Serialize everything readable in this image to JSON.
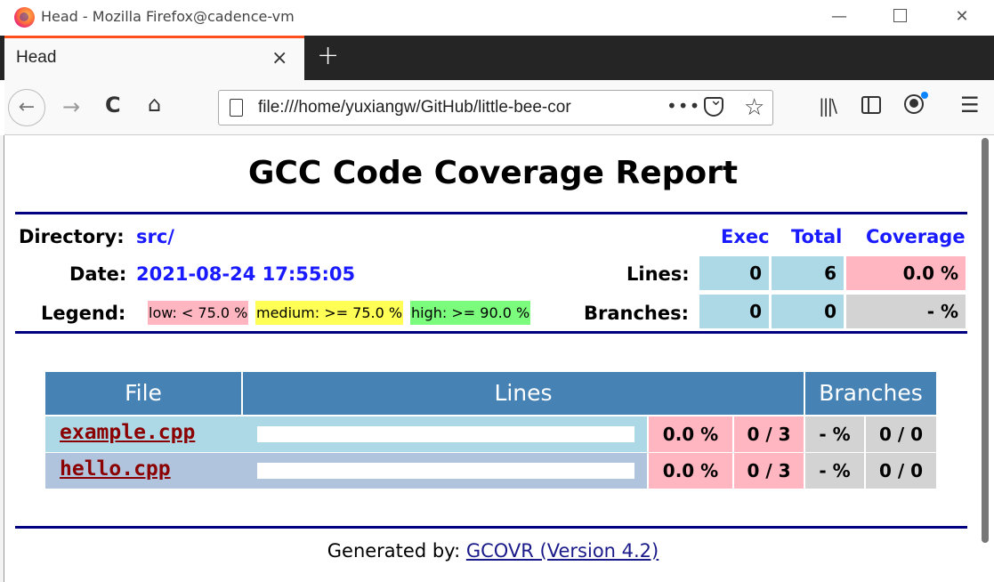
{
  "window": {
    "title": "Head - Mozilla Firefox@cadence-vm",
    "min_glyph": "—",
    "close_glyph": "✕"
  },
  "tab": {
    "label": "Head",
    "close_glyph": "×",
    "new_tab_glyph": "+"
  },
  "nav": {
    "back_glyph": "←",
    "forward_glyph": "→",
    "reload_glyph": "C",
    "home_glyph": "⌂",
    "url": "file:///home/yuxiangw/GitHub/little-bee-cor",
    "more_glyph": "•••",
    "star_glyph": "☆",
    "library_glyph": "|||\\",
    "menu_glyph": "☰",
    "account_dot_color": "#0a84ff"
  },
  "report": {
    "title": "GCC Code Coverage Report",
    "directory_label": "Directory:",
    "directory_value": "src/",
    "date_label": "Date:",
    "date_value": "2021-08-24 17:55:05",
    "legend_label": "Legend:",
    "legend": {
      "low": "low: < 75.0 %",
      "medium": "medium: >= 75.0 %",
      "high": "high: >= 90.0 %"
    },
    "columns": {
      "exec": "Exec",
      "total": "Total",
      "coverage": "Coverage"
    },
    "lines": {
      "label": "Lines:",
      "exec": "0",
      "total": "6",
      "coverage": "0.0 %"
    },
    "branches": {
      "label": "Branches:",
      "exec": "0",
      "total": "0",
      "coverage": "- %"
    },
    "colors": {
      "rule": "#000080",
      "table_header": "#4682b4",
      "low": "#ffb6c1",
      "medium": "#ffff55",
      "high": "#7cfc7c",
      "neutral": "#d3d3d3"
    }
  },
  "file_table": {
    "headers": {
      "file": "File",
      "lines": "Lines",
      "branches": "Branches"
    },
    "rows": [
      {
        "file": "example.cpp",
        "line_coverage_fraction": 0,
        "line_pct": "0.0 %",
        "line_ratio": "0 / 3",
        "branch_pct": "- %",
        "branch_ratio": "0 / 0"
      },
      {
        "file": "hello.cpp",
        "line_coverage_fraction": 0,
        "line_pct": "0.0 %",
        "line_ratio": "0 / 3",
        "branch_pct": "- %",
        "branch_ratio": "0 / 0"
      }
    ]
  },
  "footer": {
    "prefix": "Generated by:",
    "link": "GCOVR (Version 4.2)"
  }
}
